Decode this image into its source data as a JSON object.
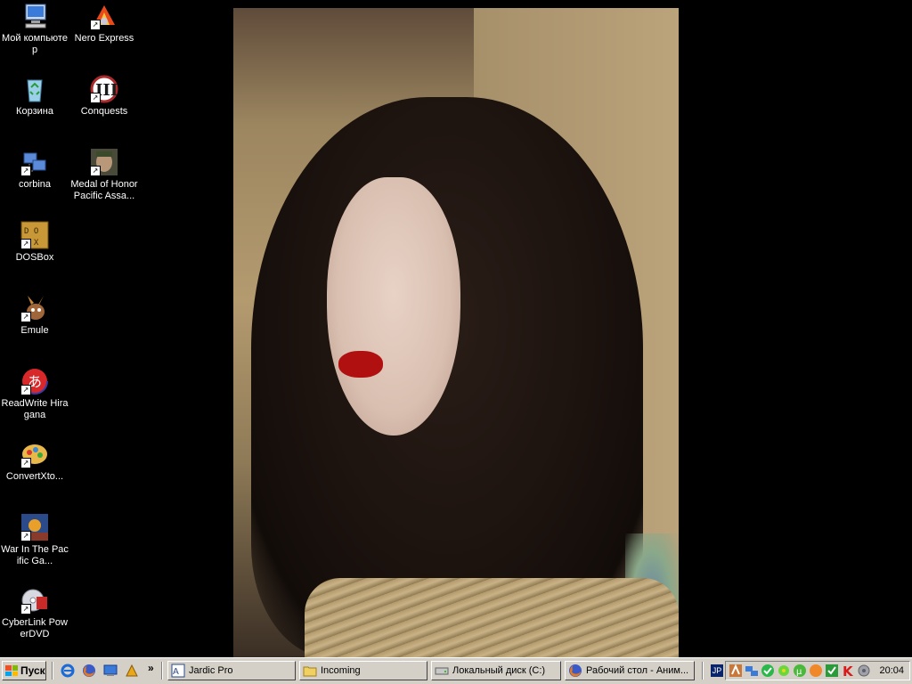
{
  "desktop": {
    "icons": [
      {
        "label": "Мой компьютер",
        "icon": "my-computer-icon"
      },
      {
        "label": "Nero Express",
        "icon": "nero-express-icon"
      },
      {
        "label": "Корзина",
        "icon": "recycle-bin-icon"
      },
      {
        "label": "Conquests",
        "icon": "civilization-conquests-icon"
      },
      {
        "label": "corbina",
        "icon": "network-connection-icon"
      },
      {
        "label": "Medal of Honor Pacific Assa...",
        "icon": "medal-of-honor-icon"
      },
      {
        "label": "DOSBox",
        "icon": "dosbox-icon"
      },
      {
        "label": "Emule",
        "icon": "emule-icon"
      },
      {
        "label": "ReadWrite Hiragana",
        "icon": "hiragana-icon"
      },
      {
        "label": "ConvertXto...",
        "icon": "convertxto-icon"
      },
      {
        "label": "War In The Pacific Ga...",
        "icon": "war-in-the-pacific-icon"
      },
      {
        "label": "CyberLink PowerDVD",
        "icon": "powerdvd-icon"
      }
    ]
  },
  "taskbar": {
    "start_label": "Пуск",
    "quick_launch": [
      "internet-explorer-icon",
      "firefox-icon",
      "show-desktop-icon",
      "winamp-icon"
    ],
    "overflow": "»",
    "tasks": [
      {
        "label": "Jardic Pro",
        "icon": "jardic-icon"
      },
      {
        "label": "Incoming",
        "icon": "folder-icon"
      },
      {
        "label": "Локальный диск (C:)",
        "icon": "drive-icon"
      },
      {
        "label": "Рабочий стол - Аним...",
        "icon": "firefox-icon"
      }
    ],
    "language": "JP",
    "tray_icons": [
      "ime-icon",
      "network-icon",
      "antivirus-icon",
      "icq-icon",
      "utorrent-icon",
      "avast-icon",
      "security-icon",
      "kaspersky-icon",
      "volume-icon"
    ],
    "clock": "20:04"
  },
  "colors": {
    "taskbar": "#d4d0c8",
    "desktop": "#000000"
  }
}
